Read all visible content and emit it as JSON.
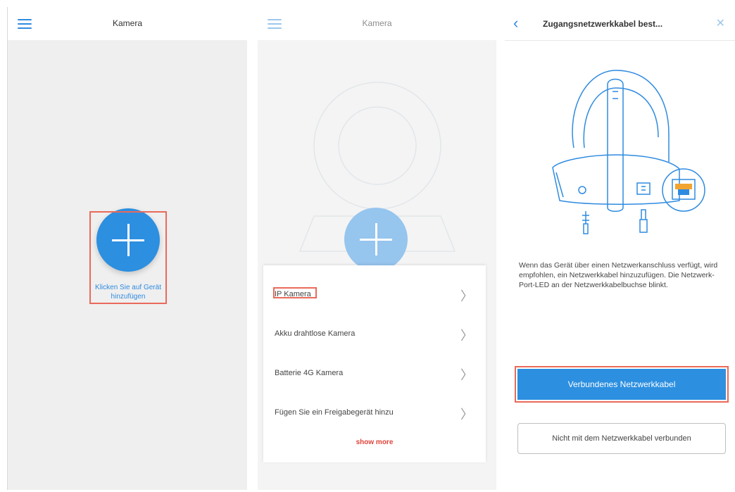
{
  "panel1": {
    "title": "Kamera",
    "menu_icon": "menu-icon",
    "add_icon": "plus-icon",
    "add_hint": "Klicken Sie auf Gerät hinzufügen"
  },
  "panel2": {
    "title": "Kamera",
    "menu_icon": "menu-icon",
    "add_icon": "plus-icon",
    "menu_items": [
      {
        "label": "IP Kamera",
        "icon": "chevron-right-icon"
      },
      {
        "label": "Akku drahtlose Kamera",
        "icon": "chevron-right-icon"
      },
      {
        "label": "Batterie 4G Kamera",
        "icon": "chevron-right-icon"
      },
      {
        "label": "Fügen Sie ein Freigabegerät hinzu",
        "icon": "chevron-right-icon"
      }
    ],
    "more_label": "show more"
  },
  "panel3": {
    "title": "Zugangsnetzwerkkabel best...",
    "back_icon": "chevron-left-icon",
    "close_icon": "close-icon",
    "description": "Wenn das Gerät über einen Netzwerkanschluss verfügt, wird empfohlen, ein Netzwerkkabel hinzuzufügen. Die Netzwerk-Port-LED an der Netzwerkkabelbuchse blinkt.",
    "primary_button": "Verbundenes Netzwerkkabel",
    "secondary_button": "Nicht mit dem Netzwerkkabel verbunden"
  },
  "colors": {
    "accent": "#2c8fe0",
    "highlight": "#e96a5a",
    "background": "#efefef"
  }
}
